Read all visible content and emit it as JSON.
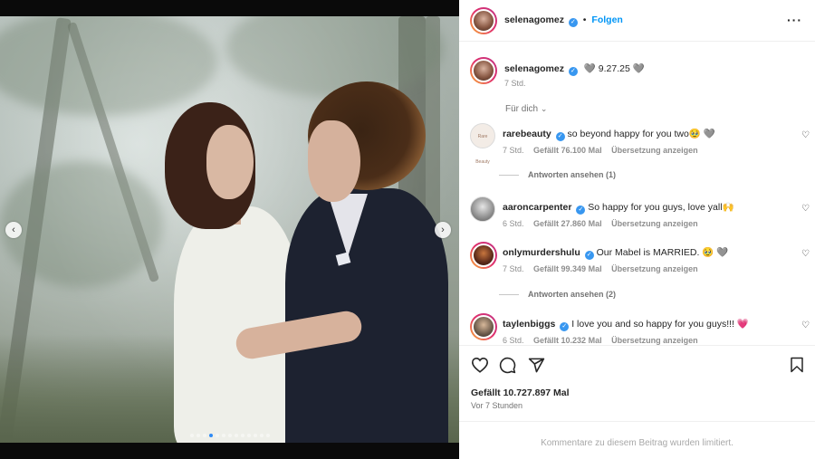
{
  "post": {
    "author": "selenagomez",
    "follow_label": "Folgen",
    "more_icon": "more-horizontal-icon",
    "carousel": {
      "slide_count": 13,
      "active_index": 3,
      "prev_icon": "chevron-left-icon",
      "next_icon": "chevron-right-icon"
    }
  },
  "caption": {
    "username": "selenagomez",
    "text": "🩶  9.27.25  🩶",
    "time": "7 Std."
  },
  "comments_filter": "Für dich",
  "comments": [
    {
      "username": "rarebeauty",
      "text": "so beyond happy for you two🥹 🩶",
      "time": "7 Std.",
      "likes": "Gefällt 76.100 Mal",
      "translate": "Übersetzung anzeigen",
      "replies": "Antworten ansehen (1)",
      "avatar_color": "#f3ece6"
    },
    {
      "username": "aaroncarpenter",
      "text": "So happy for you guys, love yall🙌",
      "time": "6 Std.",
      "likes": "Gefällt 27.860 Mal",
      "translate": "Übersetzung anzeigen",
      "replies": "",
      "avatar_color": "#9a9a9a"
    },
    {
      "username": "onlymurdershulu",
      "text": "Our Mabel is MARRIED. 🥹 🩶",
      "time": "7 Std.",
      "likes": "Gefällt 99.349 Mal",
      "translate": "Übersetzung anzeigen",
      "replies": "Antworten ansehen (2)",
      "avatar_color": "#5b2a1a"
    },
    {
      "username": "taylenbiggs",
      "text": "I love you and so happy for you guys!!! 💗",
      "time": "6 Std.",
      "likes": "Gefällt 10.232 Mal",
      "translate": "Übersetzung anzeigen",
      "replies": "",
      "avatar_color": "#6b5a4a"
    }
  ],
  "actions": {
    "like_icon": "heart-icon",
    "comment_icon": "comment-icon",
    "share_icon": "share-icon",
    "save_icon": "bookmark-icon",
    "likes": "Gefällt 10.727.897 Mal",
    "ago": "Vor 7 Stunden"
  },
  "comments_limited": "Kommentare zu diesem Beitrag wurden limitiert.",
  "colors": {
    "accent": "#0095f6",
    "verified": "#3897f0",
    "muted": "#737373"
  }
}
